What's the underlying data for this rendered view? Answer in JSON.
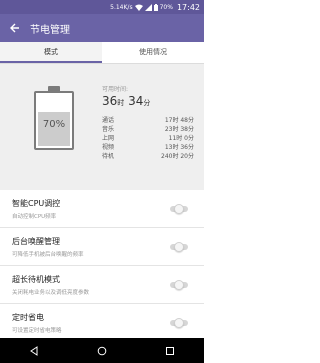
{
  "status_bar": {
    "net_speed": "5.14K/s",
    "battery_percent": "70%",
    "time": "17:42"
  },
  "app_bar": {
    "title": "节电管理"
  },
  "tabs": [
    {
      "label": "模式",
      "active": true
    },
    {
      "label": "使用情况",
      "active": false
    }
  ],
  "battery": {
    "level": 0.7,
    "label": "70%"
  },
  "usable": {
    "label": "可用时间:",
    "hours": "36",
    "hours_unit": "时",
    "minutes": "34",
    "minutes_unit": "分"
  },
  "usage": [
    {
      "name": "通话",
      "value": "17时 48分"
    },
    {
      "name": "音乐",
      "value": "23时 38分"
    },
    {
      "name": "上网",
      "value": "11时 0分"
    },
    {
      "name": "视频",
      "value": "13时 36分"
    },
    {
      "name": "待机",
      "value": "240时 20分"
    }
  ],
  "settings": [
    {
      "title": "智能CPU调控",
      "desc": "自动控制CPU频率",
      "enabled": false
    },
    {
      "title": "后台唤醒管理",
      "desc": "可降低手机被后台唤醒的频率",
      "enabled": false
    },
    {
      "title": "超长待机模式",
      "desc": "关闭耗电业务以及调低亮度参数",
      "enabled": false
    },
    {
      "title": "定时省电",
      "desc": "可设置定时省电策略",
      "enabled": false
    }
  ],
  "colors": {
    "status_bar": "#5f5799",
    "app_bar": "#6a63a6",
    "summary_bg": "#efefef"
  }
}
